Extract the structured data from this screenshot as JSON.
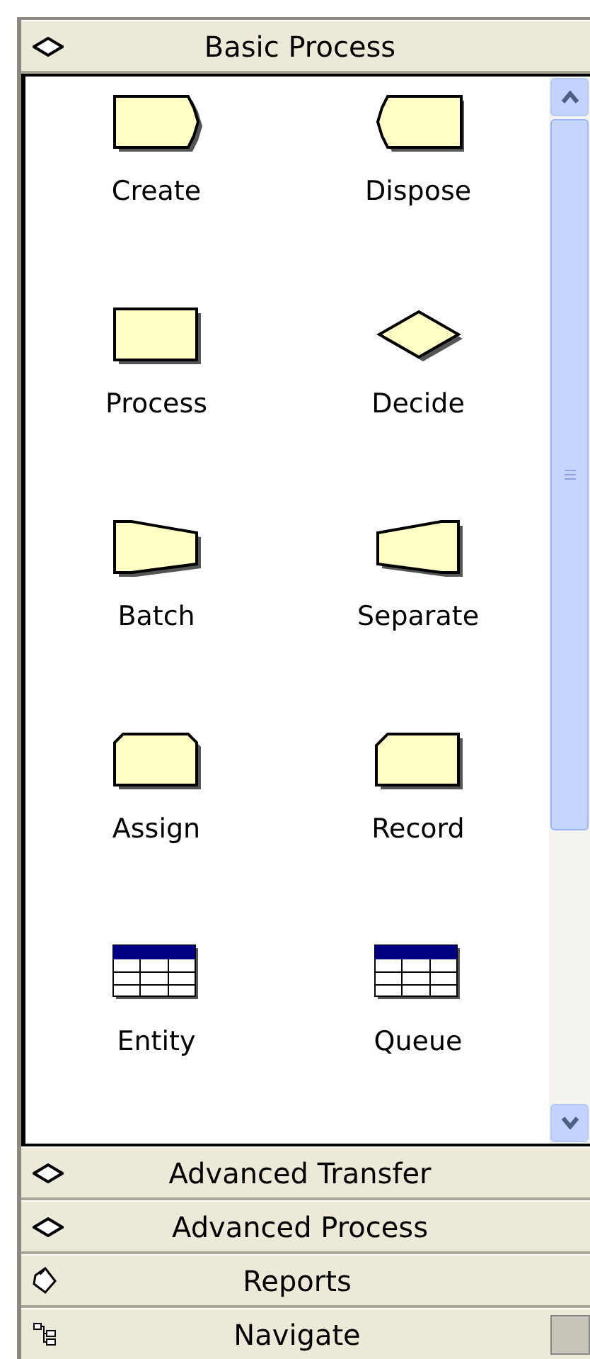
{
  "panels": [
    {
      "title": "Basic Process",
      "kind": "diamond",
      "expanded": true,
      "modules": [
        {
          "label": "Create",
          "kind": "create"
        },
        {
          "label": "Dispose",
          "kind": "dispose"
        },
        {
          "label": "Process",
          "kind": "process"
        },
        {
          "label": "Decide",
          "kind": "decide"
        },
        {
          "label": "Batch",
          "kind": "batch"
        },
        {
          "label": "Separate",
          "kind": "separate"
        },
        {
          "label": "Assign",
          "kind": "assign"
        },
        {
          "label": "Record",
          "kind": "record"
        },
        {
          "label": "Entity",
          "kind": "table"
        },
        {
          "label": "Queue",
          "kind": "table"
        }
      ]
    },
    {
      "title": "Advanced Transfer",
      "kind": "diamond",
      "expanded": false
    },
    {
      "title": "Advanced Process",
      "kind": "diamond",
      "expanded": false
    },
    {
      "title": "Reports",
      "kind": "clipboard",
      "expanded": false
    },
    {
      "title": "Navigate",
      "kind": "tree",
      "expanded": false
    }
  ]
}
